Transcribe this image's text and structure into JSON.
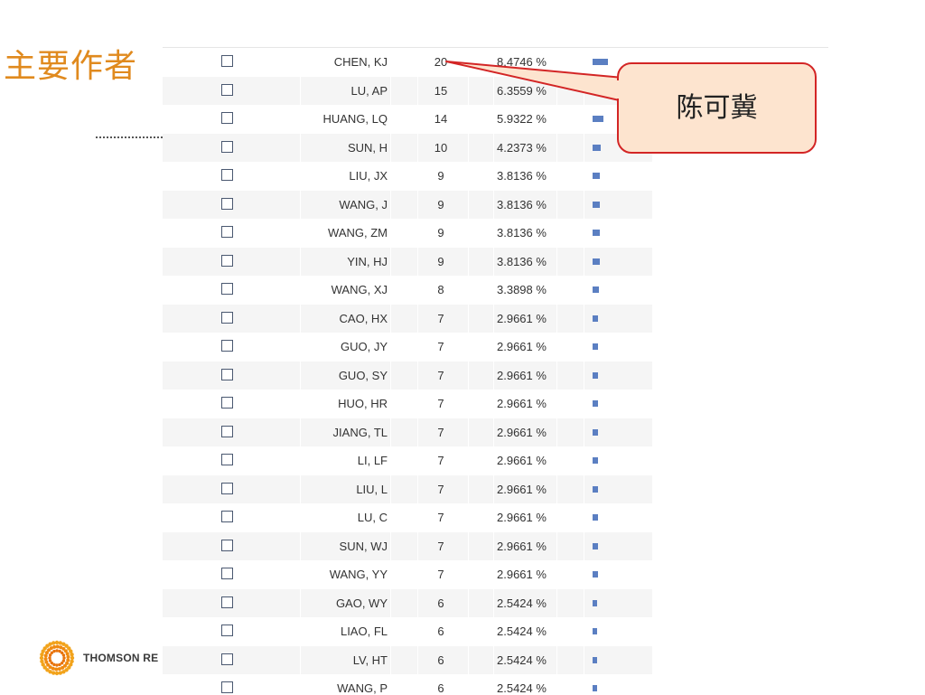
{
  "slide": {
    "title": "主要作者"
  },
  "logo": {
    "text": "THOMSON RE"
  },
  "callout": {
    "text": "陈可冀"
  },
  "colors": {
    "title": "#e08a1e",
    "bar": "#5b7fc2",
    "callout_fill": "#fde4cf",
    "callout_border": "#d32525"
  },
  "table": {
    "rows": [
      {
        "name": "CHEN, KJ",
        "count": 20,
        "percent": "8.4746 %"
      },
      {
        "name": "LU, AP",
        "count": 15,
        "percent": "6.3559 %"
      },
      {
        "name": "HUANG, LQ",
        "count": 14,
        "percent": "5.9322 %"
      },
      {
        "name": "SUN, H",
        "count": 10,
        "percent": "4.2373 %"
      },
      {
        "name": "LIU, JX",
        "count": 9,
        "percent": "3.8136 %"
      },
      {
        "name": "WANG, J",
        "count": 9,
        "percent": "3.8136 %"
      },
      {
        "name": "WANG, ZM",
        "count": 9,
        "percent": "3.8136 %"
      },
      {
        "name": "YIN, HJ",
        "count": 9,
        "percent": "3.8136 %"
      },
      {
        "name": "WANG, XJ",
        "count": 8,
        "percent": "3.3898 %"
      },
      {
        "name": "CAO, HX",
        "count": 7,
        "percent": "2.9661 %"
      },
      {
        "name": "GUO, JY",
        "count": 7,
        "percent": "2.9661 %"
      },
      {
        "name": "GUO, SY",
        "count": 7,
        "percent": "2.9661 %"
      },
      {
        "name": "HUO, HR",
        "count": 7,
        "percent": "2.9661 %"
      },
      {
        "name": "JIANG, TL",
        "count": 7,
        "percent": "2.9661 %"
      },
      {
        "name": "LI, LF",
        "count": 7,
        "percent": "2.9661 %"
      },
      {
        "name": "LIU, L",
        "count": 7,
        "percent": "2.9661 %"
      },
      {
        "name": "LU, C",
        "count": 7,
        "percent": "2.9661 %"
      },
      {
        "name": "SUN, WJ",
        "count": 7,
        "percent": "2.9661 %"
      },
      {
        "name": "WANG, YY",
        "count": 7,
        "percent": "2.9661 %"
      },
      {
        "name": "GAO, WY",
        "count": 6,
        "percent": "2.5424 %"
      },
      {
        "name": "LIAO, FL",
        "count": 6,
        "percent": "2.5424 %"
      },
      {
        "name": "LV, HT",
        "count": 6,
        "percent": "2.5424 %"
      },
      {
        "name": "WANG, P",
        "count": 6,
        "percent": "2.5424 %"
      }
    ]
  }
}
